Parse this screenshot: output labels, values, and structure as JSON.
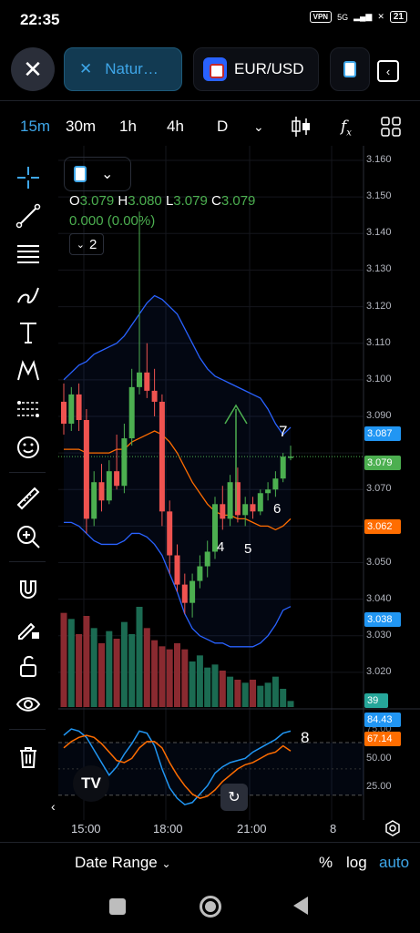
{
  "status": {
    "time": "22:35",
    "vpn": "VPN",
    "network": "5G",
    "battery": "21"
  },
  "tabs": {
    "active_label": "Natur…",
    "pair_label": "EUR/USD"
  },
  "timeframes": [
    "15m",
    "30m",
    "1h",
    "4h",
    "D"
  ],
  "active_timeframe": "15m",
  "legend": {
    "o_label": "O",
    "o": "3.079",
    "h_label": "H",
    "h": "3.080",
    "l_label": "L",
    "l": "3.079",
    "c_label": "C",
    "c": "3.079",
    "change": "0.000 (0.00%)",
    "indicators_count": "2"
  },
  "price_axis": [
    "3.160",
    "3.150",
    "3.140",
    "3.130",
    "3.120",
    "3.110",
    "3.100",
    "3.090",
    "3.070",
    "3.060",
    "3.050",
    "3.040",
    "3.030",
    "3.020"
  ],
  "price_tags": {
    "upper_band": "3.087",
    "last": "3.079",
    "middle_band": "3.062",
    "lower_band": "3.038",
    "volume": "39"
  },
  "oscillator_axis": [
    "75.00",
    "50.00",
    "25.00"
  ],
  "oscillator_tags": {
    "k": "84.43",
    "d": "67.14"
  },
  "annotations": [
    "4",
    "5",
    "6",
    "7",
    "8"
  ],
  "time_axis": [
    "15:00",
    "18:00",
    "21:00",
    "8"
  ],
  "bottom": {
    "date_range": "Date Range",
    "percent": "%",
    "log": "log",
    "auto": "auto"
  },
  "colors": {
    "up": "#4caf50",
    "down": "#ef5350",
    "accent": "#3ea6e8",
    "band": "#2962ff",
    "mid": "#ff6d00"
  },
  "chart_data": {
    "type": "candlestick",
    "ylim": [
      3.015,
      3.162
    ],
    "candles": [
      [
        3.094,
        3.099,
        3.085,
        3.088
      ],
      [
        3.088,
        3.098,
        3.086,
        3.096
      ],
      [
        3.096,
        3.099,
        3.086,
        3.089
      ],
      [
        3.089,
        3.092,
        3.058,
        3.062
      ],
      [
        3.062,
        3.075,
        3.06,
        3.072
      ],
      [
        3.072,
        3.077,
        3.064,
        3.067
      ],
      [
        3.067,
        3.078,
        3.066,
        3.075
      ],
      [
        3.075,
        3.085,
        3.07,
        3.071
      ],
      [
        3.071,
        3.088,
        3.069,
        3.084
      ],
      [
        3.084,
        3.103,
        3.082,
        3.098
      ],
      [
        3.098,
        3.146,
        3.096,
        3.102
      ],
      [
        3.102,
        3.11,
        3.095,
        3.097
      ],
      [
        3.097,
        3.103,
        3.09,
        3.094
      ],
      [
        3.094,
        3.096,
        3.06,
        3.064
      ],
      [
        3.064,
        3.067,
        3.047,
        3.052
      ],
      [
        3.052,
        3.055,
        3.042,
        3.044
      ],
      [
        3.044,
        3.047,
        3.036,
        3.039
      ],
      [
        3.039,
        3.047,
        3.035,
        3.045
      ],
      [
        3.045,
        3.052,
        3.043,
        3.049
      ],
      [
        3.049,
        3.056,
        3.046,
        3.053
      ],
      [
        3.053,
        3.068,
        3.051,
        3.066
      ],
      [
        3.066,
        3.071,
        3.059,
        3.062
      ],
      [
        3.062,
        3.074,
        3.06,
        3.072
      ],
      [
        3.072,
        3.076,
        3.061,
        3.063
      ],
      [
        3.063,
        3.068,
        3.06,
        3.066
      ],
      [
        3.066,
        3.068,
        3.062,
        3.064
      ],
      [
        3.064,
        3.07,
        3.063,
        3.069
      ],
      [
        3.069,
        3.072,
        3.067,
        3.07
      ],
      [
        3.07,
        3.075,
        3.068,
        3.073
      ],
      [
        3.073,
        3.08,
        3.072,
        3.079
      ],
      [
        3.079,
        3.082,
        3.078,
        3.079
      ]
    ],
    "volumes": [
      62,
      58,
      48,
      60,
      52,
      42,
      50,
      45,
      56,
      48,
      66,
      52,
      44,
      40,
      38,
      42,
      38,
      30,
      34,
      26,
      28,
      24,
      20,
      18,
      16,
      18,
      14,
      16,
      20,
      12,
      4
    ],
    "bb_upper": [
      3.1,
      3.102,
      3.104,
      3.105,
      3.107,
      3.108,
      3.109,
      3.11,
      3.112,
      3.115,
      3.118,
      3.121,
      3.123,
      3.122,
      3.12,
      3.118,
      3.114,
      3.11,
      3.106,
      3.103,
      3.101,
      3.1,
      3.099,
      3.098,
      3.097,
      3.096,
      3.095,
      3.092,
      3.088,
      3.085,
      3.087
    ],
    "bb_lower": [
      3.061,
      3.061,
      3.06,
      3.058,
      3.056,
      3.055,
      3.055,
      3.055,
      3.056,
      3.058,
      3.058,
      3.057,
      3.055,
      3.052,
      3.047,
      3.042,
      3.036,
      3.032,
      3.03,
      3.029,
      3.028,
      3.028,
      3.027,
      3.027,
      3.027,
      3.027,
      3.028,
      3.03,
      3.033,
      3.037,
      3.038
    ],
    "bb_middle": [
      3.081,
      3.081,
      3.081,
      3.08,
      3.08,
      3.08,
      3.08,
      3.081,
      3.081,
      3.083,
      3.084,
      3.085,
      3.086,
      3.085,
      3.083,
      3.08,
      3.076,
      3.072,
      3.069,
      3.066,
      3.064,
      3.063,
      3.063,
      3.062,
      3.062,
      3.061,
      3.06,
      3.06,
      3.059,
      3.06,
      3.062
    ],
    "osc_k": [
      82,
      88,
      86,
      80,
      68,
      56,
      44,
      52,
      64,
      74,
      86,
      84,
      72,
      50,
      32,
      22,
      16,
      18,
      26,
      34,
      46,
      52,
      56,
      58,
      60,
      66,
      70,
      74,
      78,
      84,
      86
    ],
    "osc_d": [
      70,
      76,
      80,
      82,
      80,
      74,
      66,
      58,
      56,
      60,
      70,
      76,
      76,
      70,
      56,
      44,
      34,
      26,
      22,
      24,
      30,
      38,
      44,
      50,
      54,
      56,
      60,
      64,
      66,
      72,
      67
    ],
    "osc_ylim": [
      10,
      95
    ]
  }
}
